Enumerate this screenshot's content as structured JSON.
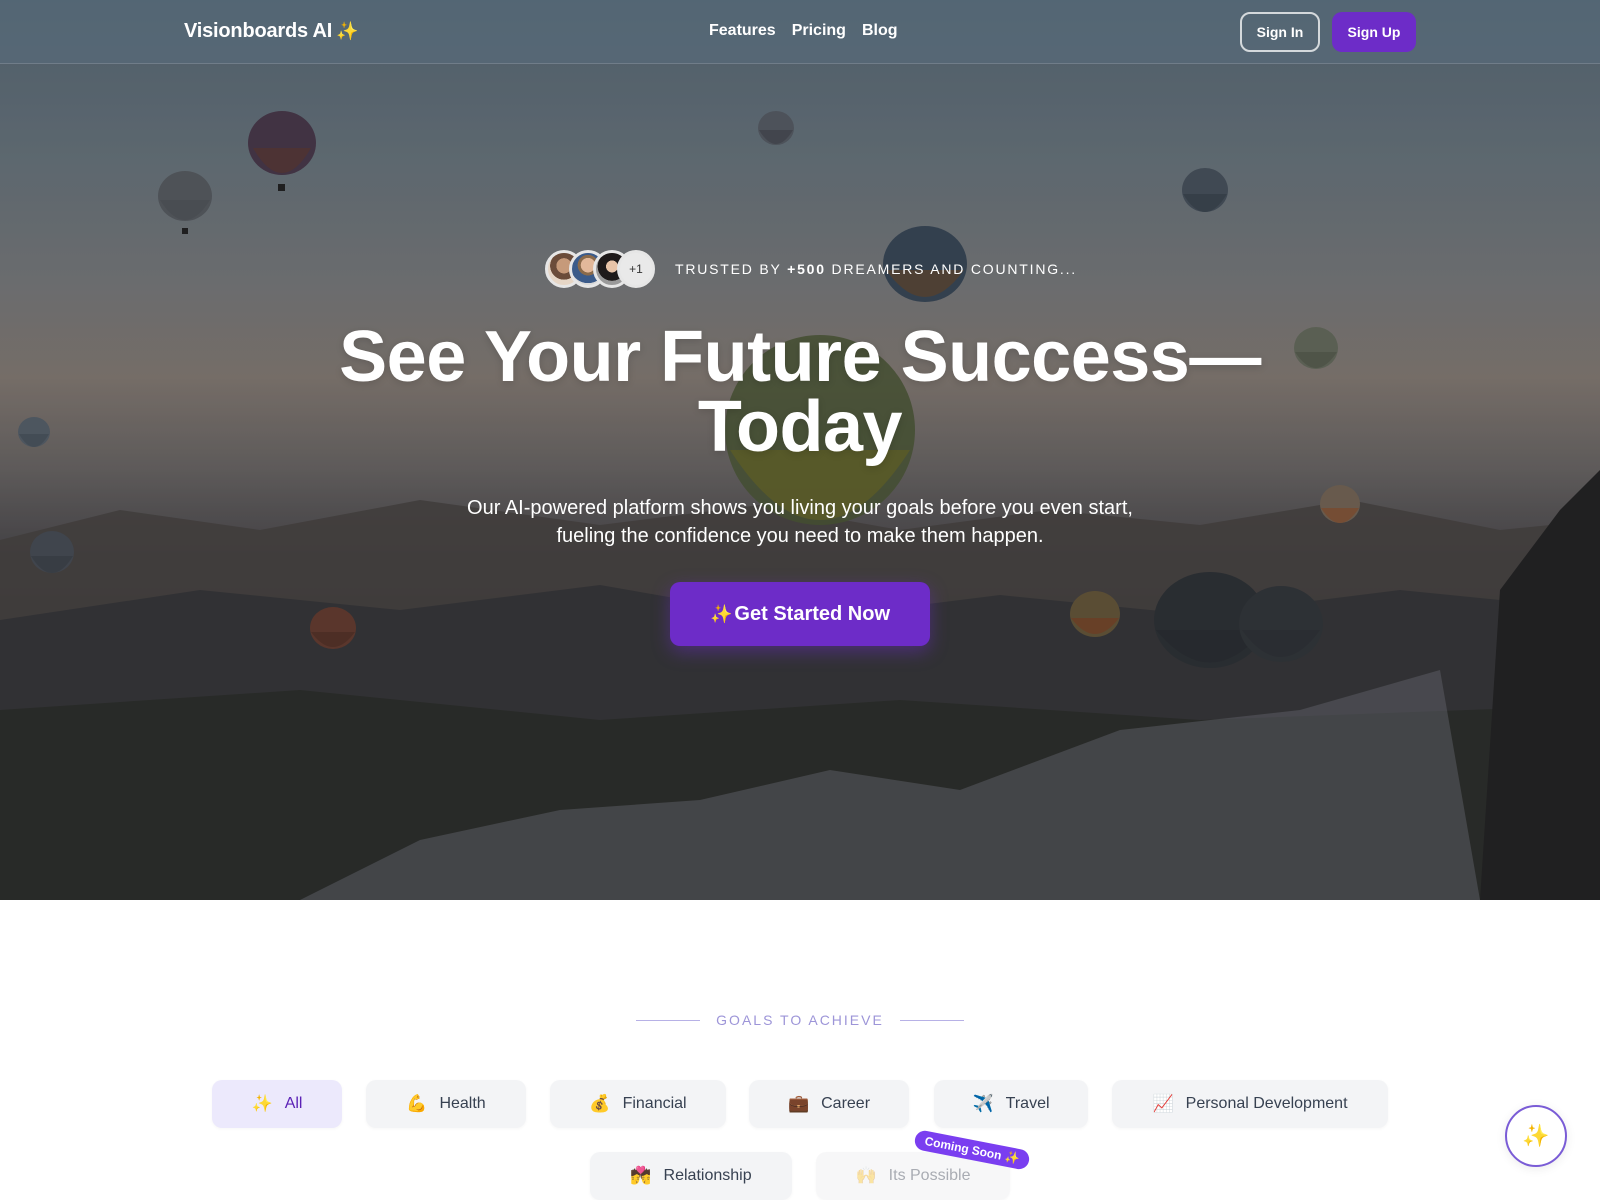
{
  "navbar": {
    "logo_text": "Visionboards AI",
    "logo_icon": "sparkles-icon",
    "links": [
      "Features",
      "Pricing",
      "Blog"
    ],
    "sign_in": "Sign In",
    "sign_up": "Sign Up"
  },
  "hero": {
    "trust": {
      "avatars": [
        "avatar-1",
        "avatar-2",
        "avatar-3"
      ],
      "more_count": "+1",
      "text_before": "TRUSTED BY ",
      "count": "+500",
      "text_after": " DREAMERS AND COUNTING..."
    },
    "headline_line1": "See Your Future Success—",
    "headline_line2": "Today",
    "subheadline": "Our AI-powered platform shows you living your goals before you even start, fueling the confidence you need to make them happen.",
    "cta_icon": "✨",
    "cta_label": "Get Started Now"
  },
  "goals": {
    "section_label": "GOALS TO ACHIEVE",
    "categories": [
      {
        "emoji": "✨",
        "label": "All",
        "icon": "sparkles-icon",
        "state": "active"
      },
      {
        "emoji": "💪",
        "label": "Health",
        "icon": "flexed-biceps-icon",
        "state": "default"
      },
      {
        "emoji": "💰",
        "label": "Financial",
        "icon": "money-bag-icon",
        "state": "default"
      },
      {
        "emoji": "💼",
        "label": "Career",
        "icon": "briefcase-icon",
        "state": "default"
      },
      {
        "emoji": "✈️",
        "label": "Travel",
        "icon": "airplane-icon",
        "state": "default"
      },
      {
        "emoji": "📈",
        "label": "Personal Development",
        "icon": "chart-increasing-icon",
        "state": "default"
      },
      {
        "emoji": "💏",
        "label": "Relationship",
        "icon": "couple-kiss-icon",
        "state": "default"
      },
      {
        "emoji": "🙌",
        "label": "Its Possible",
        "icon": "raising-hands-icon",
        "state": "disabled"
      }
    ],
    "coming_soon_badge": "Coming Soon",
    "coming_soon_icon": "✨"
  },
  "fab": {
    "icon": "✨"
  }
}
